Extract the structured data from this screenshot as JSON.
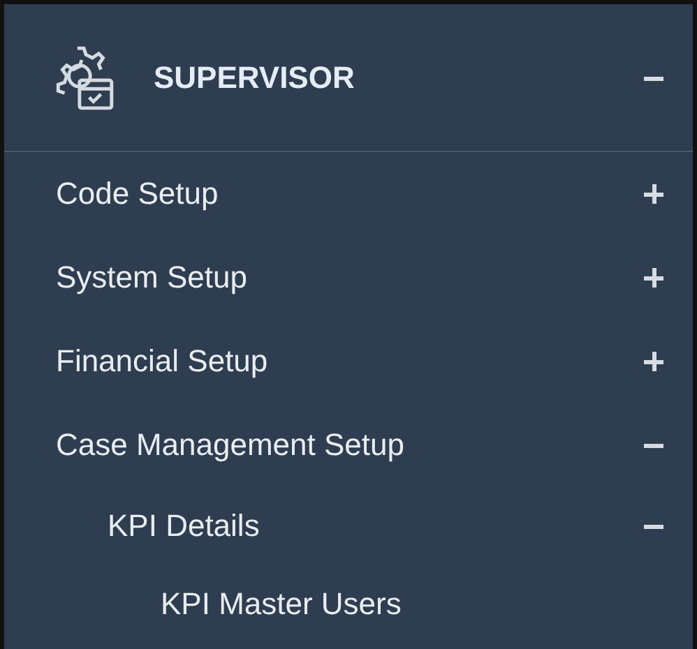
{
  "header": {
    "title": "SUPERVISOR",
    "expanded": true
  },
  "items": [
    {
      "label": "Code Setup",
      "expanded": false
    },
    {
      "label": "System Setup",
      "expanded": false
    },
    {
      "label": "Financial Setup",
      "expanded": false
    },
    {
      "label": "Case Management Setup",
      "expanded": true,
      "children": [
        {
          "label": "KPI Details",
          "expanded": true,
          "children": [
            {
              "label": "KPI Master Users"
            }
          ]
        }
      ]
    }
  ]
}
